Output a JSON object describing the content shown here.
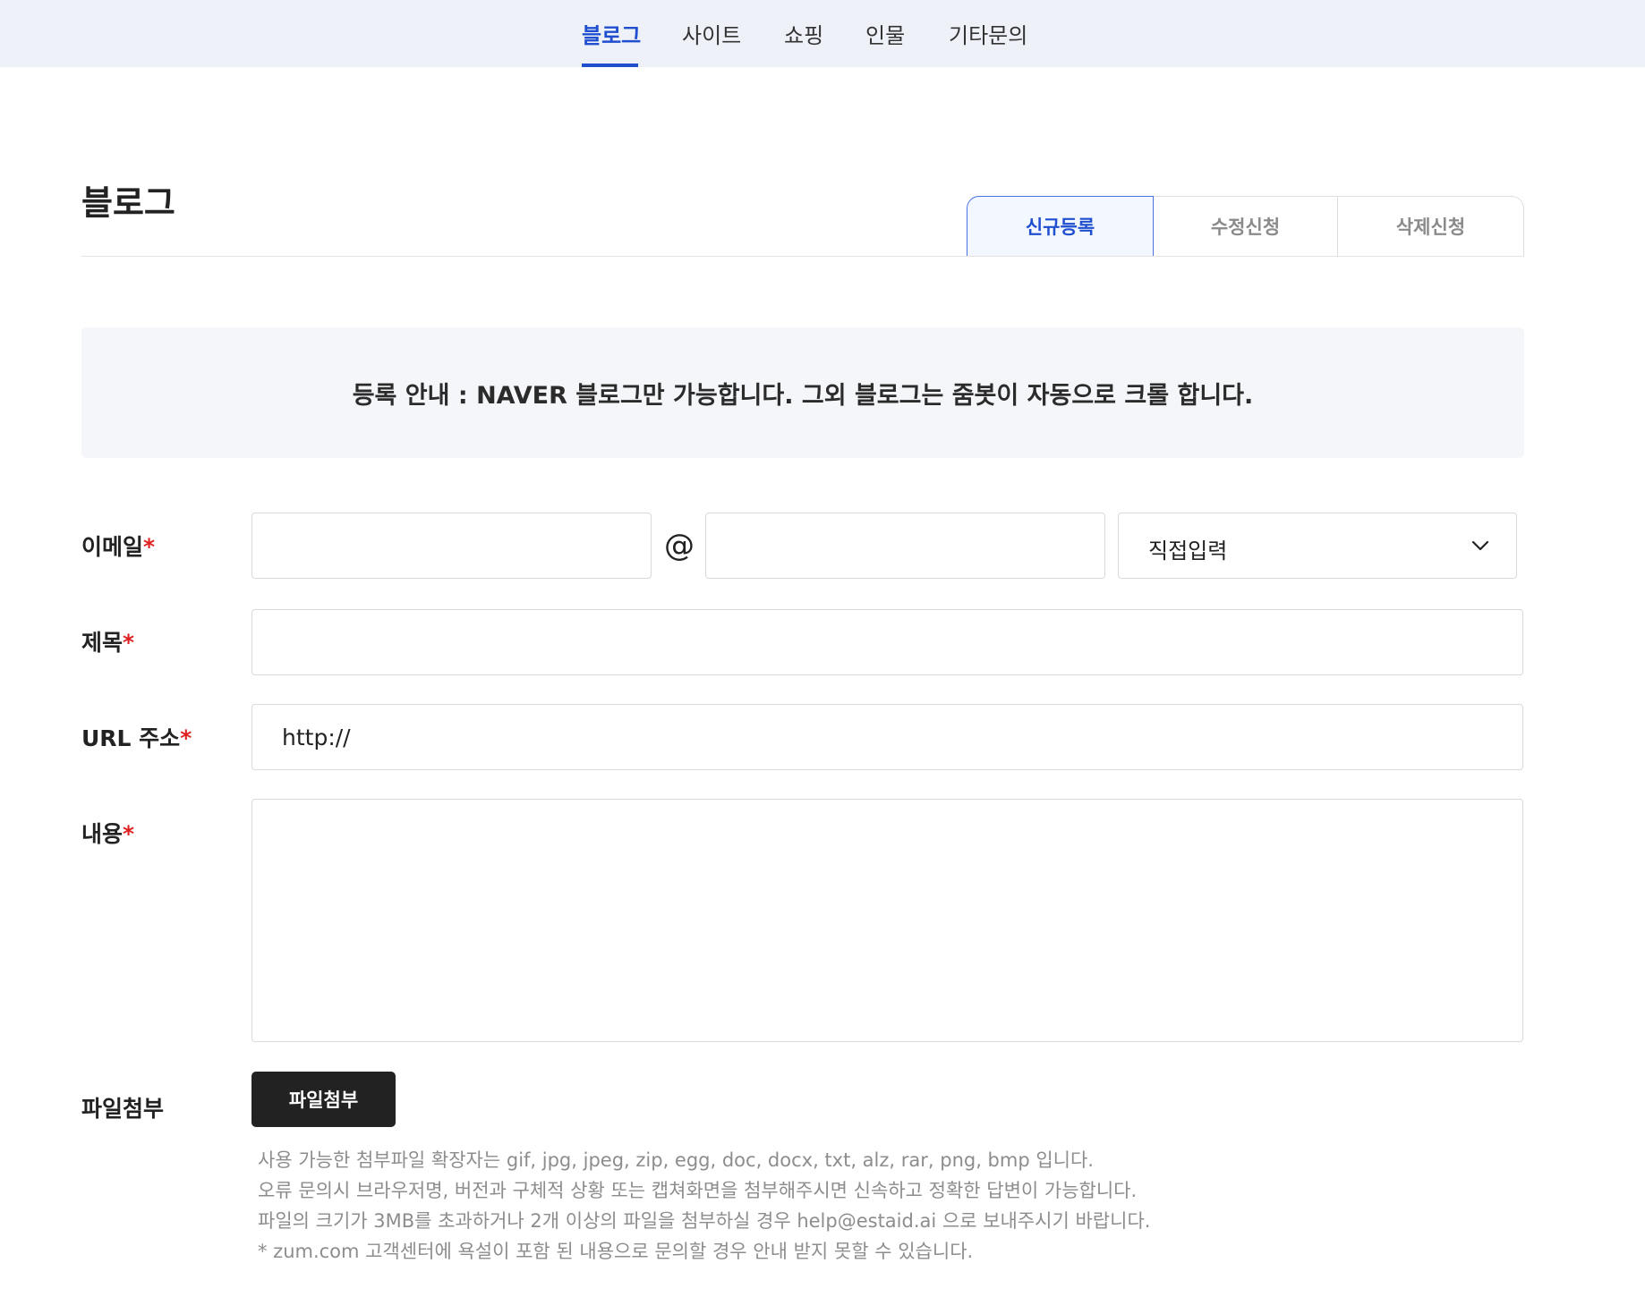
{
  "nav": {
    "tabs": [
      "블로그",
      "사이트",
      "쇼핑",
      "인물",
      "기타문의"
    ],
    "active_index": 0
  },
  "page": {
    "title": "블로그"
  },
  "segments": {
    "items": [
      "신규등록",
      "수정신청",
      "삭제신청"
    ],
    "active_index": 0
  },
  "notice": {
    "text": "등록 안내 : NAVER 블로그만 가능합니다. 그외 블로그는 줌봇이 자동으로 크롤 합니다."
  },
  "form": {
    "required_mark": "*",
    "email": {
      "label": "이메일",
      "local_value": "",
      "at_symbol": "@",
      "domain_value": "",
      "domain_select": "직접입력"
    },
    "title": {
      "label": "제목",
      "value": ""
    },
    "url": {
      "label": "URL 주소",
      "value": "http://"
    },
    "content": {
      "label": "내용",
      "value": ""
    },
    "attachment": {
      "label": "파일첨부",
      "button_label": "파일첨부",
      "help_lines": [
        "사용 가능한 첨부파일 확장자는 gif, jpg, jpeg, zip, egg, doc, docx, txt, alz, rar, png, bmp 입니다.",
        "오류 문의시 브라우저명, 버전과 구체적 상황 또는 캡쳐화면을 첨부해주시면 신속하고 정확한 답변이 가능합니다.",
        "파일의 크기가 3MB를 초과하거나 2개 이상의 파일을 첨부하실 경우 help@estaid.ai 으로 보내주시기 바랍니다.",
        " * zum.com 고객센터에 욕설이 포함 된 내용으로 문의할 경우 안내 받지 못할 수 있습니다."
      ]
    }
  },
  "colors": {
    "accent": "#1f4fcf",
    "required": "#e02020",
    "nav_bg": "#eef1f8",
    "notice_bg": "#f5f6f9",
    "button_bg": "#222222"
  }
}
